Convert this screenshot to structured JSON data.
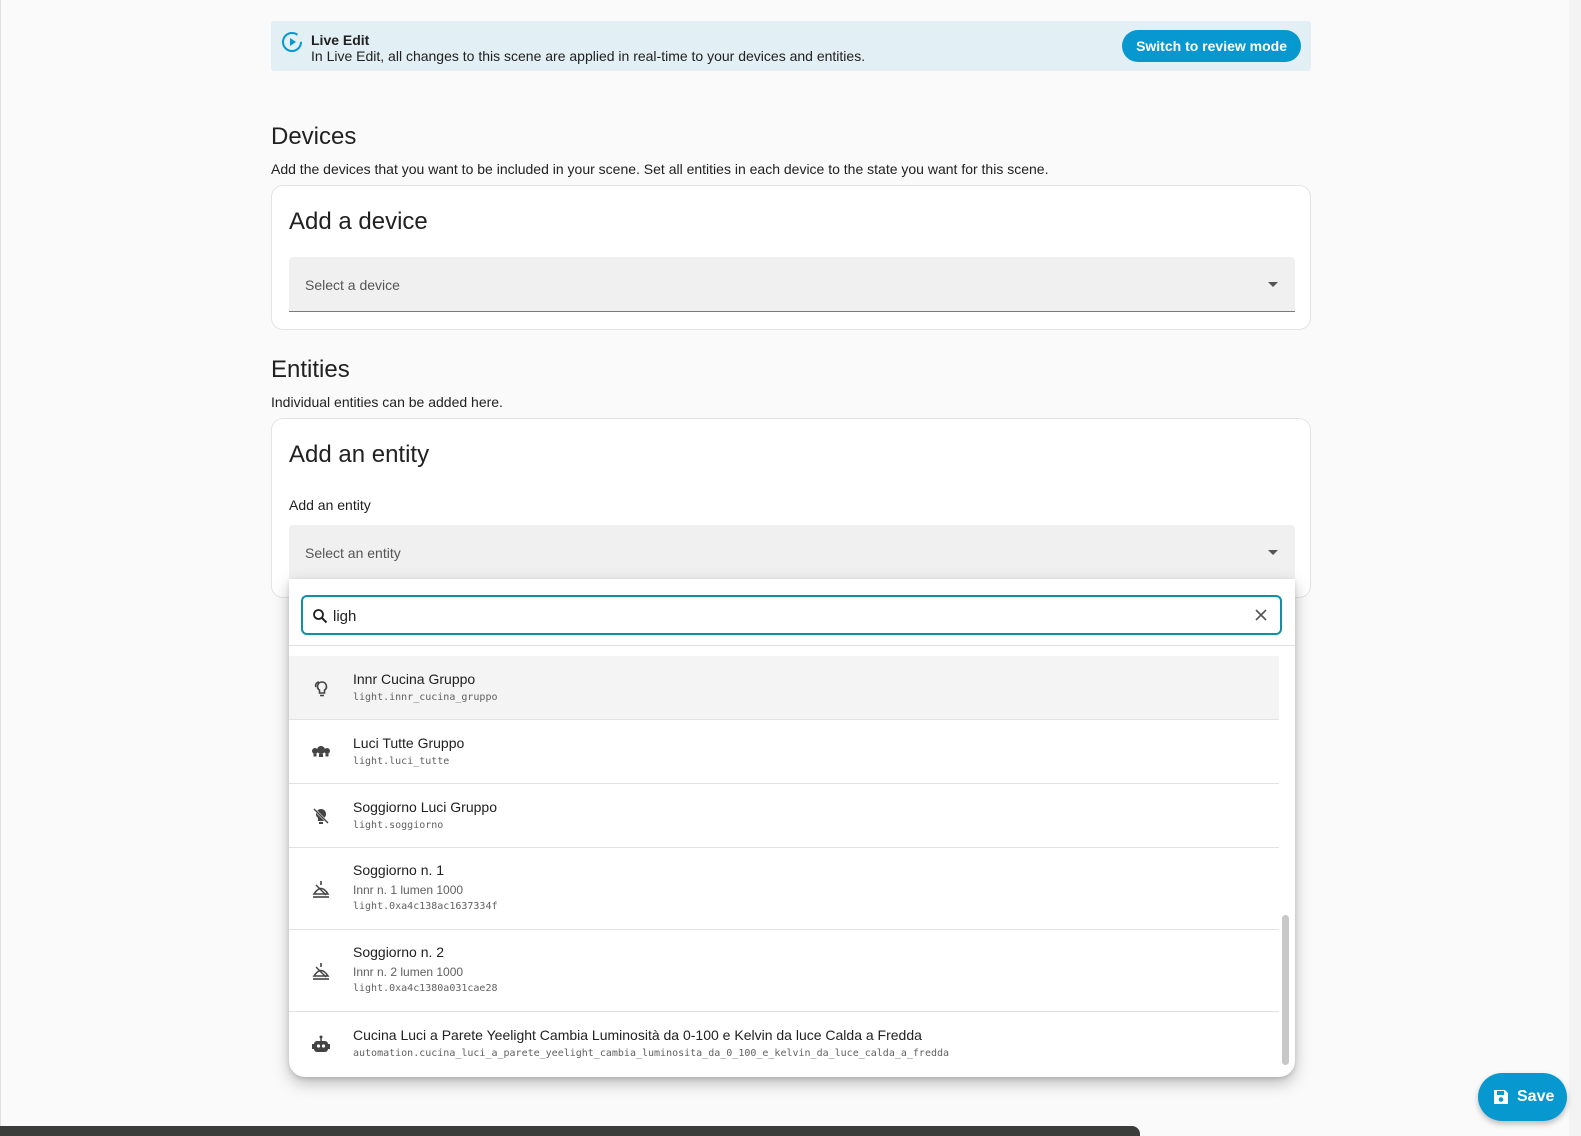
{
  "banner": {
    "title": "Live Edit",
    "text": "In Live Edit, all changes to this scene are applied in real-time to your devices and entities.",
    "button_label": "Switch to review mode",
    "icon": "play-circle-icon"
  },
  "devices": {
    "title": "Devices",
    "description": "Add the devices that you want to be included in your scene. Set all entities in each device to the state you want for this scene.",
    "card_title": "Add a device",
    "select_placeholder": "Select a device"
  },
  "entities": {
    "title": "Entities",
    "description": "Individual entities can be added here.",
    "card_title": "Add an entity",
    "field_label": "Add an entity",
    "select_placeholder": "Select an entity"
  },
  "search": {
    "value": "ligh"
  },
  "results": [
    {
      "name": "Innr Cucina Gruppo",
      "sub": "",
      "id": "light.innr_cucina_gruppo",
      "icon": "lightbulb-group-icon"
    },
    {
      "name": "Luci Tutte Gruppo",
      "sub": "",
      "id": "light.luci_tutte",
      "icon": "lightbulb-multiple-icon"
    },
    {
      "name": "Soggiorno Luci Gruppo",
      "sub": "",
      "id": "light.soggiorno",
      "icon": "lightbulb-off-icon"
    },
    {
      "name": "Soggiorno n. 1",
      "sub": "Innr n. 1 lumen 1000",
      "id": "light.0xa4c138ac1637334f",
      "icon": "ceiling-light-icon"
    },
    {
      "name": "Soggiorno n. 2",
      "sub": "Innr n. 2 lumen 1000",
      "id": "light.0xa4c1380a031cae28",
      "icon": "ceiling-light-icon"
    },
    {
      "name": "Cucina Luci a Parete Yeelight Cambia Luminosità da 0-100 e Kelvin da luce Calda a Fredda",
      "sub": "",
      "id": "automation.cucina_luci_a_parete_yeelight_cambia_luminosita_da_0_100_e_kelvin_da_luce_calda_a_fredda",
      "icon": "robot-icon"
    }
  ],
  "save_button": {
    "label": "Save",
    "icon": "floppy-icon"
  },
  "colors": {
    "accent": "#0798cf",
    "banner_bg": "#e2eff5",
    "search_border": "#0f8fa8"
  }
}
